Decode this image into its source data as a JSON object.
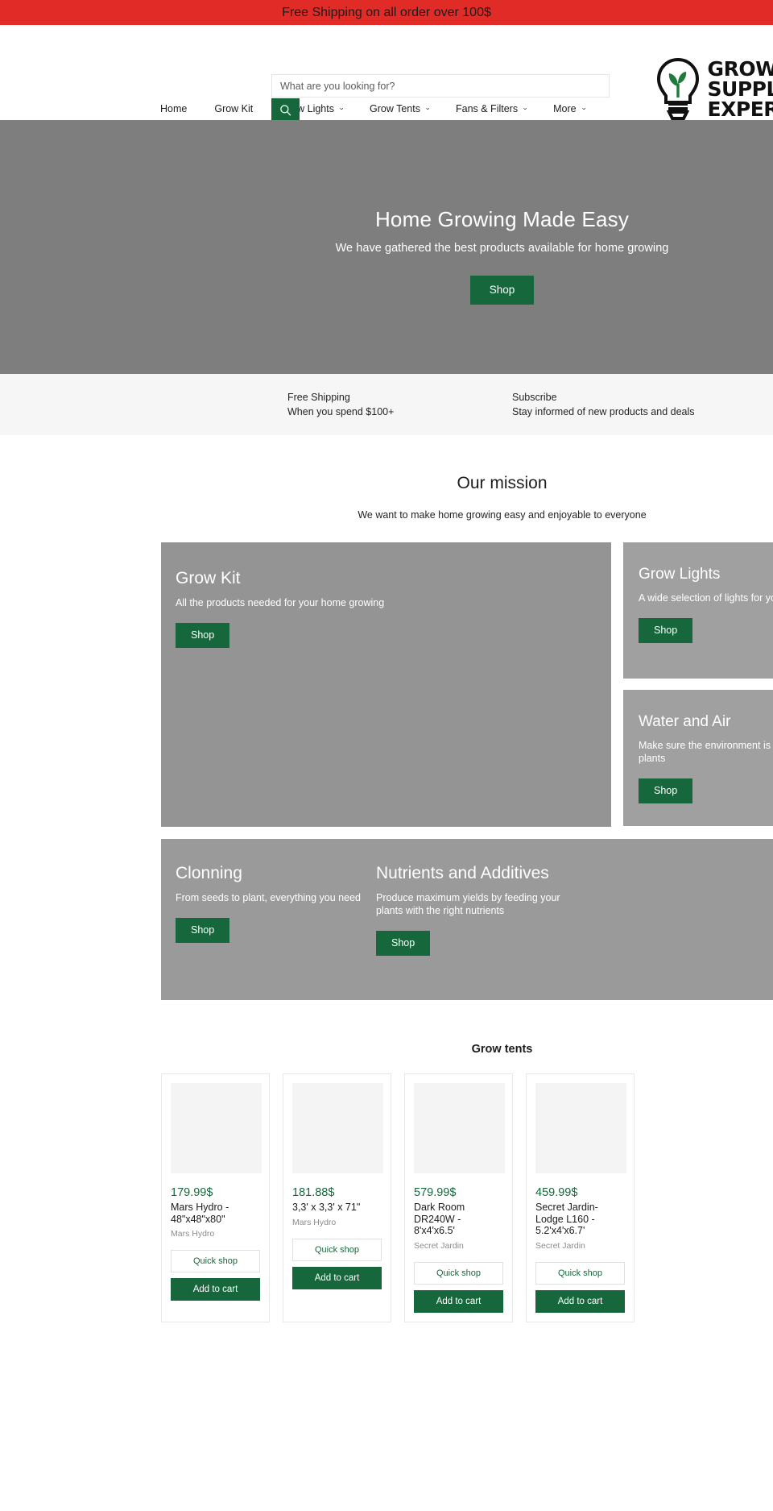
{
  "announcement": {
    "text": "Free Shipping on all order over 100$"
  },
  "header": {
    "search": {
      "placeholder": "What are you looking for?",
      "value": "",
      "button_icon": "search-icon"
    },
    "logo": {
      "line1": "GROW",
      "line2": "SUPPLY",
      "line3": "EXPERTS",
      "icon": "lightbulb-sprout-icon"
    }
  },
  "nav": {
    "items": [
      {
        "label": "Home",
        "has_caret": false
      },
      {
        "label": "Grow Kit",
        "has_caret": false
      },
      {
        "label": "Grow Lights",
        "has_caret": true
      },
      {
        "label": "Grow Tents",
        "has_caret": true
      },
      {
        "label": "Fans & Filters",
        "has_caret": true
      },
      {
        "label": "More",
        "has_caret": true
      }
    ],
    "caret_glyph": "‹"
  },
  "hero": {
    "title": "Home Growing Made Easy",
    "subtitle": "We have gathered the best products available for home growing",
    "cta": "Shop"
  },
  "features": [
    {
      "title": "Free Shipping",
      "desc": "When you spend $100+"
    },
    {
      "title": "Subscribe",
      "desc": "Stay informed of new products and deals"
    }
  ],
  "mission": {
    "title": "Our mission",
    "subtitle": "We want to make home growing easy and enjoyable to everyone"
  },
  "promos": {
    "big": {
      "title": "Grow Kit",
      "desc": "All the products needed for your home growing",
      "cta": "Shop"
    },
    "side": [
      {
        "title": "Grow Lights",
        "desc": "A wide selection of lights for your plants",
        "cta": "Shop"
      },
      {
        "title": "Water and Air",
        "desc": "Make sure the environment is right for your plants",
        "cta": "Shop"
      }
    ],
    "bottom": [
      {
        "title": "Clonning",
        "desc": "From seeds to plant, everything you need",
        "cta": "Shop"
      },
      {
        "title": "Nutrients and Additives",
        "desc": "Produce maximum yields by feeding your plants with the right nutrients",
        "cta": "Shop"
      }
    ]
  },
  "products_section": {
    "title": "Grow tents",
    "quick_shop_label": "Quick shop",
    "add_to_cart_label": "Add to cart",
    "items": [
      {
        "price": "179.99$",
        "name": "Mars Hydro - 48\"x48\"x80\"",
        "vendor": "Mars Hydro"
      },
      {
        "price": "181.88$",
        "name": "3,3' x 3,3' x 71\"",
        "vendor": "Mars Hydro"
      },
      {
        "price": "579.99$",
        "name": "Dark Room DR240W - 8'x4'x6.5'",
        "vendor": "Secret Jardin"
      },
      {
        "price": "459.99$",
        "name": "Secret Jardin- Lodge L160 - 5.2'x4'x6.7'",
        "vendor": "Secret Jardin"
      }
    ]
  },
  "colors": {
    "announcement_red": "#e02b27",
    "brand_green": "#16683c",
    "hero_gray": "#7e7e7e",
    "feature_strip": "#f6f6f6"
  }
}
